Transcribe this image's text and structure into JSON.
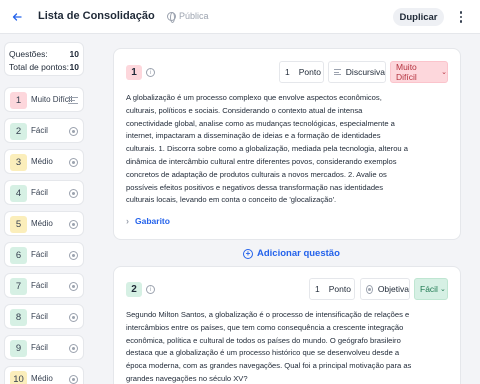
{
  "header": {
    "back_icon": "arrow-left-icon",
    "title": "Lista de Consolidação | Mu…",
    "privacy": "Pública",
    "duplicate_label": "Duplicar",
    "accent": "#2563eb"
  },
  "stats": {
    "questions_label": "Questões:",
    "questions_value": "10",
    "points_label": "Total de pontos:",
    "points_value": "10"
  },
  "sidebar": {
    "items": [
      {
        "num": "1",
        "difficulty": "Muito Difícil",
        "icon": "lines",
        "color": "#fdd7dc"
      },
      {
        "num": "2",
        "difficulty": "Fácil",
        "icon": "radio",
        "color": "#d6f0e4"
      },
      {
        "num": "3",
        "difficulty": "Médio",
        "icon": "radio",
        "color": "#fbeebb"
      },
      {
        "num": "4",
        "difficulty": "Fácil",
        "icon": "radio",
        "color": "#d6f0e4"
      },
      {
        "num": "5",
        "difficulty": "Médio",
        "icon": "radio",
        "color": "#fbeebb"
      },
      {
        "num": "6",
        "difficulty": "Fácil",
        "icon": "radio",
        "color": "#d6f0e4"
      },
      {
        "num": "7",
        "difficulty": "Fácil",
        "icon": "radio",
        "color": "#d6f0e4"
      },
      {
        "num": "8",
        "difficulty": "Fácil",
        "icon": "radio",
        "color": "#d6f0e4"
      },
      {
        "num": "9",
        "difficulty": "Fácil",
        "icon": "radio",
        "color": "#d6f0e4"
      },
      {
        "num": "10",
        "difficulty": "Médio",
        "icon": "radio",
        "color": "#fbeebb"
      }
    ]
  },
  "questions": [
    {
      "num": "1",
      "points_value": "1",
      "points_label": "Ponto",
      "type": "Discursiva",
      "difficulty": "Muito Difícil",
      "text_lines": [
        "A globalização é um processo complexo que envolve aspectos econômicos,",
        "culturais, políticos e sociais. Considerando o contexto atual de intensa",
        "conectividade global, analise como as mudanças tecnológicas, especialmente a",
        "internet, impactaram a disseminação de ideias e a formação de identidades",
        "culturais. 1. Discorra sobre como a globalização, mediada pela tecnologia, alterou a",
        "dinâmica de intercâmbio cultural entre diferentes povos, considerando exemplos",
        "concretos de adaptação de produtos culturais a novos mercados. 2. Avalie os",
        "possíveis efeitos positivos e negativos dessa transformação nas identidades",
        "culturais locais, levando em conta o conceito de 'glocalização'."
      ],
      "answer_label": "Gabarito"
    },
    {
      "num": "2",
      "points_value": "1",
      "points_label": "Ponto",
      "type": "Objetiva",
      "difficulty": "Fácil",
      "text_lines": [
        "Segundo Milton Santos, a globalização é o processo de intensificação de relações e",
        "intercâmbios entre os países, que tem como consequência a crescente integração",
        "econômica, política e cultural de todos os países do mundo. O geógrafo brasileiro",
        "destaca que a globalização é um processo histórico que se desenvolveu desde a",
        "época moderna, com as grandes navegações. Qual foi a principal motivação para as",
        "grandes navegações no século XV?"
      ]
    }
  ],
  "add_question_label": "Adicionar questão"
}
